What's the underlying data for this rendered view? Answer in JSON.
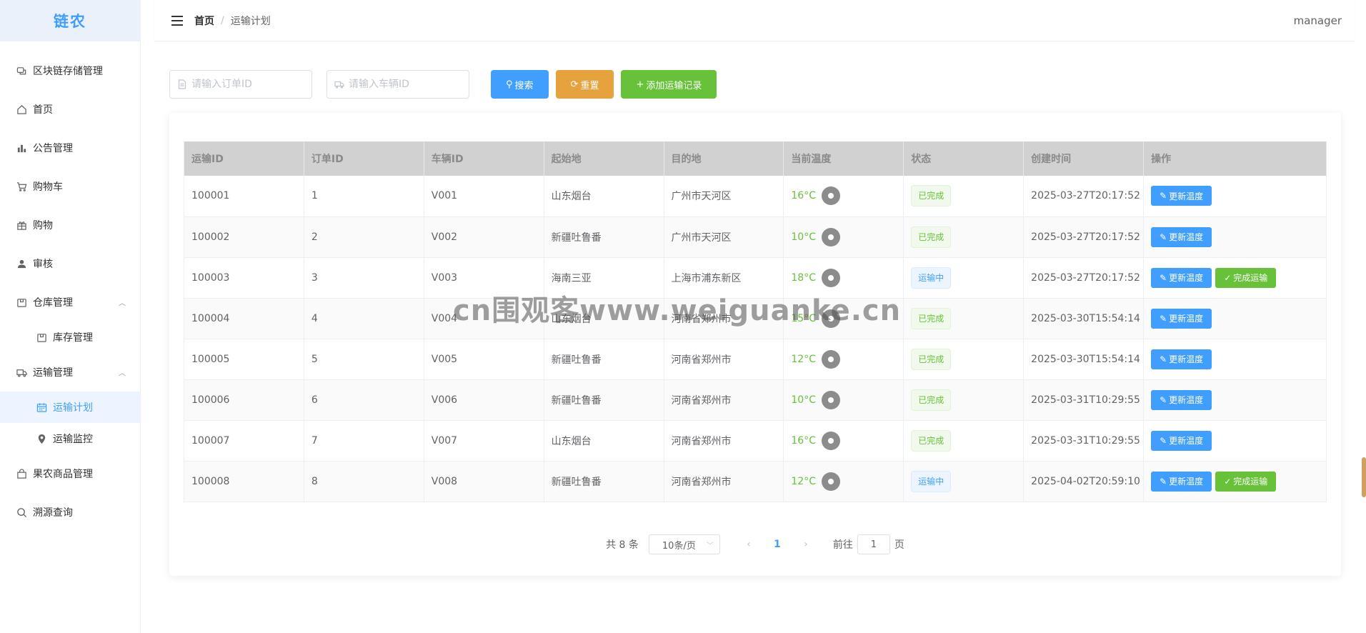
{
  "logo": "链农",
  "sidebar": {
    "items": [
      {
        "label": "区块链存储管理"
      },
      {
        "label": "首页"
      },
      {
        "label": "公告管理"
      },
      {
        "label": "购物车"
      },
      {
        "label": "购物"
      },
      {
        "label": "审核"
      },
      {
        "label": "仓库管理"
      },
      {
        "label": "库存管理"
      },
      {
        "label": "运输管理"
      },
      {
        "label": "运输计划"
      },
      {
        "label": "运输监控"
      },
      {
        "label": "果农商品管理"
      },
      {
        "label": "溯源查询"
      }
    ]
  },
  "header": {
    "breadcrumb_home": "首页",
    "breadcrumb_sep": "/",
    "breadcrumb_current": "运输计划",
    "user": "manager"
  },
  "search": {
    "order_placeholder": "请输入订单ID",
    "vehicle_placeholder": "请输入车辆ID",
    "search_label": "搜索",
    "reset_label": "重置",
    "add_label": "添加运输记录"
  },
  "table": {
    "columns": [
      "运输ID",
      "订单ID",
      "车辆ID",
      "起始地",
      "目的地",
      "当前温度",
      "状态",
      "创建时间",
      "操作"
    ],
    "update_label": "更新温度",
    "complete_label": "完成运输",
    "rows": [
      {
        "id": "100001",
        "order": "1",
        "vehicle": "V001",
        "from": "山东烟台",
        "to": "广州市天河区",
        "temp": "16°C",
        "status": "已完成",
        "time": "2025-03-27T20:17:52"
      },
      {
        "id": "100002",
        "order": "2",
        "vehicle": "V002",
        "from": "新疆吐鲁番",
        "to": "广州市天河区",
        "temp": "10°C",
        "status": "已完成",
        "time": "2025-03-27T20:17:52"
      },
      {
        "id": "100003",
        "order": "3",
        "vehicle": "V003",
        "from": "海南三亚",
        "to": "上海市浦东新区",
        "temp": "18°C",
        "status": "运输中",
        "time": "2025-03-27T20:17:52"
      },
      {
        "id": "100004",
        "order": "4",
        "vehicle": "V004",
        "from": "山东烟台",
        "to": "河南省郑州市",
        "temp": "15°C",
        "status": "已完成",
        "time": "2025-03-30T15:54:14"
      },
      {
        "id": "100005",
        "order": "5",
        "vehicle": "V005",
        "from": "新疆吐鲁番",
        "to": "河南省郑州市",
        "temp": "12°C",
        "status": "已完成",
        "time": "2025-03-30T15:54:14"
      },
      {
        "id": "100006",
        "order": "6",
        "vehicle": "V006",
        "from": "新疆吐鲁番",
        "to": "河南省郑州市",
        "temp": "10°C",
        "status": "已完成",
        "time": "2025-03-31T10:29:55"
      },
      {
        "id": "100007",
        "order": "7",
        "vehicle": "V007",
        "from": "山东烟台",
        "to": "河南省郑州市",
        "temp": "16°C",
        "status": "已完成",
        "time": "2025-03-31T10:29:55"
      },
      {
        "id": "100008",
        "order": "8",
        "vehicle": "V008",
        "from": "新疆吐鲁番",
        "to": "河南省郑州市",
        "temp": "12°C",
        "status": "运输中",
        "time": "2025-04-02T20:59:10"
      }
    ]
  },
  "pagination": {
    "total": "共 8 条",
    "page_size": "10条/页",
    "current": "1",
    "goto_prefix": "前往",
    "goto_value": "1",
    "goto_suffix": "页"
  },
  "watermark": "cn围观客www.weiguanke.cn",
  "colors": {
    "primary": "#409eff",
    "warning": "#e6a23c",
    "success": "#67c23a"
  }
}
